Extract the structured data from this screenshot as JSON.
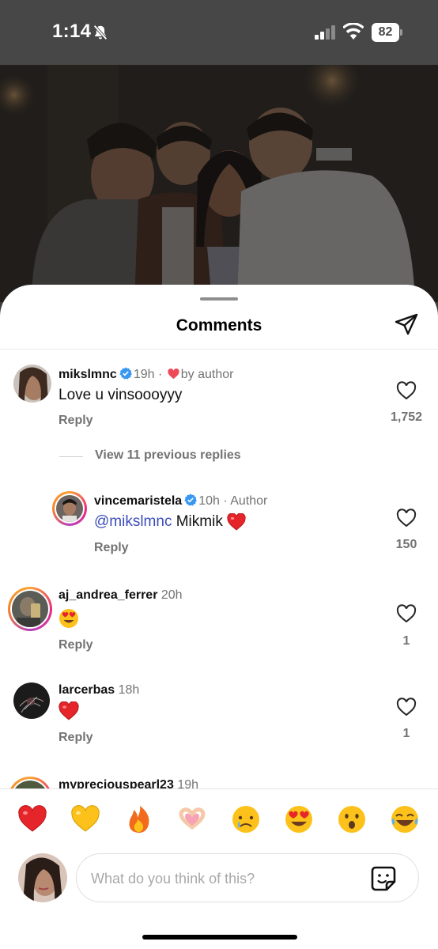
{
  "status_bar": {
    "time": "1:14",
    "battery": "82"
  },
  "sheet": {
    "title": "Comments"
  },
  "comments": [
    {
      "username": "mikslmnc",
      "meta": "19h · ",
      "liked_by": "by author",
      "text": "Love u vinsoooyyy",
      "reply_label": "Reply",
      "likes": "1,752"
    },
    {
      "view_replies": "View 11 previous replies"
    },
    {
      "username": "vincemaristela",
      "meta": "10h · Author",
      "mention": "@mikslmnc",
      "text": " Mikmik ",
      "reply_label": "Reply",
      "likes": "150"
    },
    {
      "username": "aj_andrea_ferrer",
      "meta": "20h",
      "reply_label": "Reply",
      "likes": "1"
    },
    {
      "username": "larcerbas",
      "meta": "18h",
      "reply_label": "Reply",
      "likes": "1"
    },
    {
      "username": "mypreciouspearl23",
      "meta": "19h"
    }
  ],
  "reactions": [
    "heart",
    "yellow-heart",
    "fire",
    "heart-hands",
    "crying",
    "heart-eyes",
    "surprised",
    "laughing"
  ],
  "composer": {
    "placeholder": "What do you think of this?"
  },
  "colors": {
    "heart_red": "#ed4956",
    "verified_blue": "#3897f0",
    "mention": "#3b4db8",
    "muted_text": "#737373"
  }
}
